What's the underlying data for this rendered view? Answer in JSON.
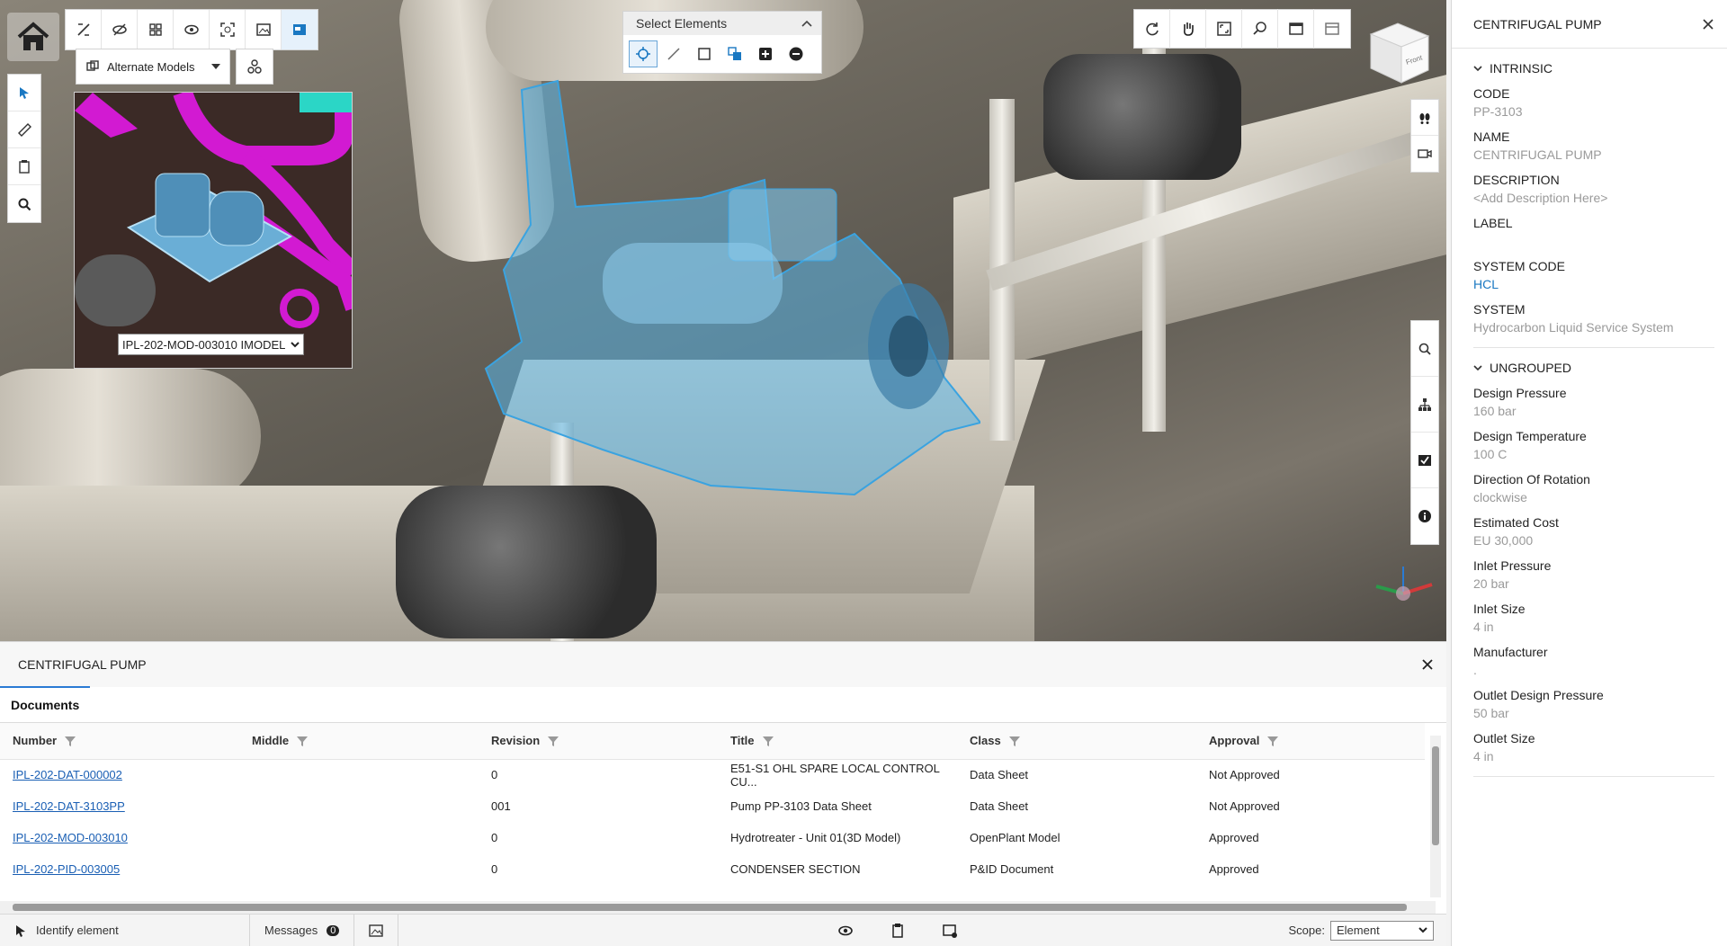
{
  "viewport": {
    "alt_models_label": "Alternate Models",
    "model_select_value": "IPL-202-MOD-003010 IMODEL",
    "select_panel_title": "Select Elements"
  },
  "view_cube": {
    "face_label": "Front"
  },
  "bottom_panel": {
    "title": "CENTRIFUGAL PUMP",
    "tabs": [
      {
        "label": "Documents"
      }
    ],
    "columns": [
      "Number",
      "Middle",
      "Revision",
      "Title",
      "Class",
      "Approval"
    ],
    "rows": [
      {
        "number": "IPL-202-DAT-000002",
        "middle": "",
        "revision": "0",
        "title": "E51-S1 OHL SPARE LOCAL CONTROL CU...",
        "class": "Data Sheet",
        "approval": "Not Approved"
      },
      {
        "number": "IPL-202-DAT-3103PP",
        "middle": "",
        "revision": "001",
        "title": "Pump PP-3103 Data Sheet",
        "class": "Data Sheet",
        "approval": "Not Approved"
      },
      {
        "number": "IPL-202-MOD-003010",
        "middle": "",
        "revision": "0",
        "title": "Hydrotreater - Unit 01(3D Model)",
        "class": "OpenPlant Model",
        "approval": "Approved"
      },
      {
        "number": "IPL-202-PID-003005",
        "middle": "",
        "revision": "0",
        "title": "CONDENSER SECTION",
        "class": "P&ID Document",
        "approval": "Approved"
      }
    ]
  },
  "status_bar": {
    "identify_label": "Identify element",
    "messages_label": "Messages",
    "messages_count": "0",
    "scope_label": "Scope:",
    "scope_value": "Element"
  },
  "properties": {
    "title": "CENTRIFUGAL PUMP",
    "sections": [
      {
        "name": "INTRINSIC",
        "items": [
          {
            "key": "CODE",
            "value": "PP-3103",
            "link": false
          },
          {
            "key": "NAME",
            "value": "CENTRIFUGAL PUMP",
            "link": false
          },
          {
            "key": "DESCRIPTION",
            "value": "<Add Description Here>",
            "link": false
          },
          {
            "key": "LABEL",
            "value": "",
            "link": false
          },
          {
            "key": "SYSTEM CODE",
            "value": "HCL",
            "link": true
          },
          {
            "key": "SYSTEM",
            "value": "Hydrocarbon Liquid Service System",
            "link": false
          }
        ]
      },
      {
        "name": "UNGROUPED",
        "items": [
          {
            "key": "Design Pressure",
            "value": "160 bar",
            "link": false
          },
          {
            "key": "Design Temperature",
            "value": "100 C",
            "link": false
          },
          {
            "key": "Direction Of Rotation",
            "value": "clockwise",
            "link": false
          },
          {
            "key": "Estimated Cost",
            "value": "EU 30,000",
            "link": false
          },
          {
            "key": "Inlet Pressure",
            "value": "20 bar",
            "link": false
          },
          {
            "key": "Inlet Size",
            "value": "4 in",
            "link": false
          },
          {
            "key": "Manufacturer",
            "value": ".",
            "link": false
          },
          {
            "key": "Outlet Design Pressure",
            "value": "50 bar",
            "link": false
          },
          {
            "key": "Outlet Size",
            "value": "4 in",
            "link": false
          }
        ]
      }
    ]
  },
  "colors": {
    "accent": "#2a7bd4",
    "link": "#1a5fb4",
    "highlight": "#5ab4e6",
    "pipe_magenta": "#d21ad2"
  }
}
